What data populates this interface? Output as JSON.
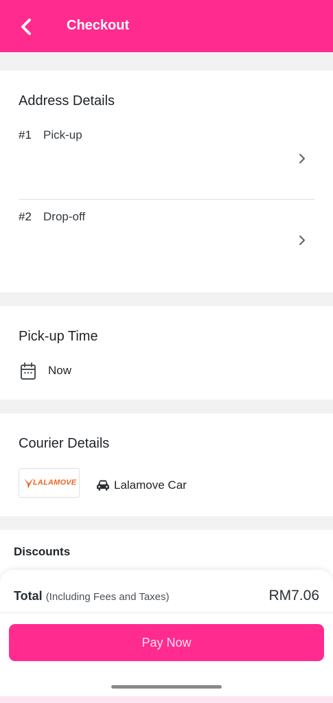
{
  "header": {
    "title": "Checkout",
    "accent": "#ff2b8f"
  },
  "address": {
    "title": "Address Details",
    "items": [
      {
        "num": "#1",
        "label": "Pick-up"
      },
      {
        "num": "#2",
        "label": "Drop-off"
      }
    ]
  },
  "pickup_time": {
    "title": "Pick-up Time",
    "value": "Now",
    "icon": "calendar-icon"
  },
  "courier": {
    "title": "Courier Details",
    "logo_text": "LALAMOVE",
    "vehicle": "Lalamove Car",
    "icon": "car-icon"
  },
  "discounts": {
    "title": "Discounts"
  },
  "summary": {
    "total_label": "Total",
    "total_sub": "(Including Fees and Taxes)",
    "total_amount": "RM7.06",
    "pay_label": "Pay Now"
  }
}
